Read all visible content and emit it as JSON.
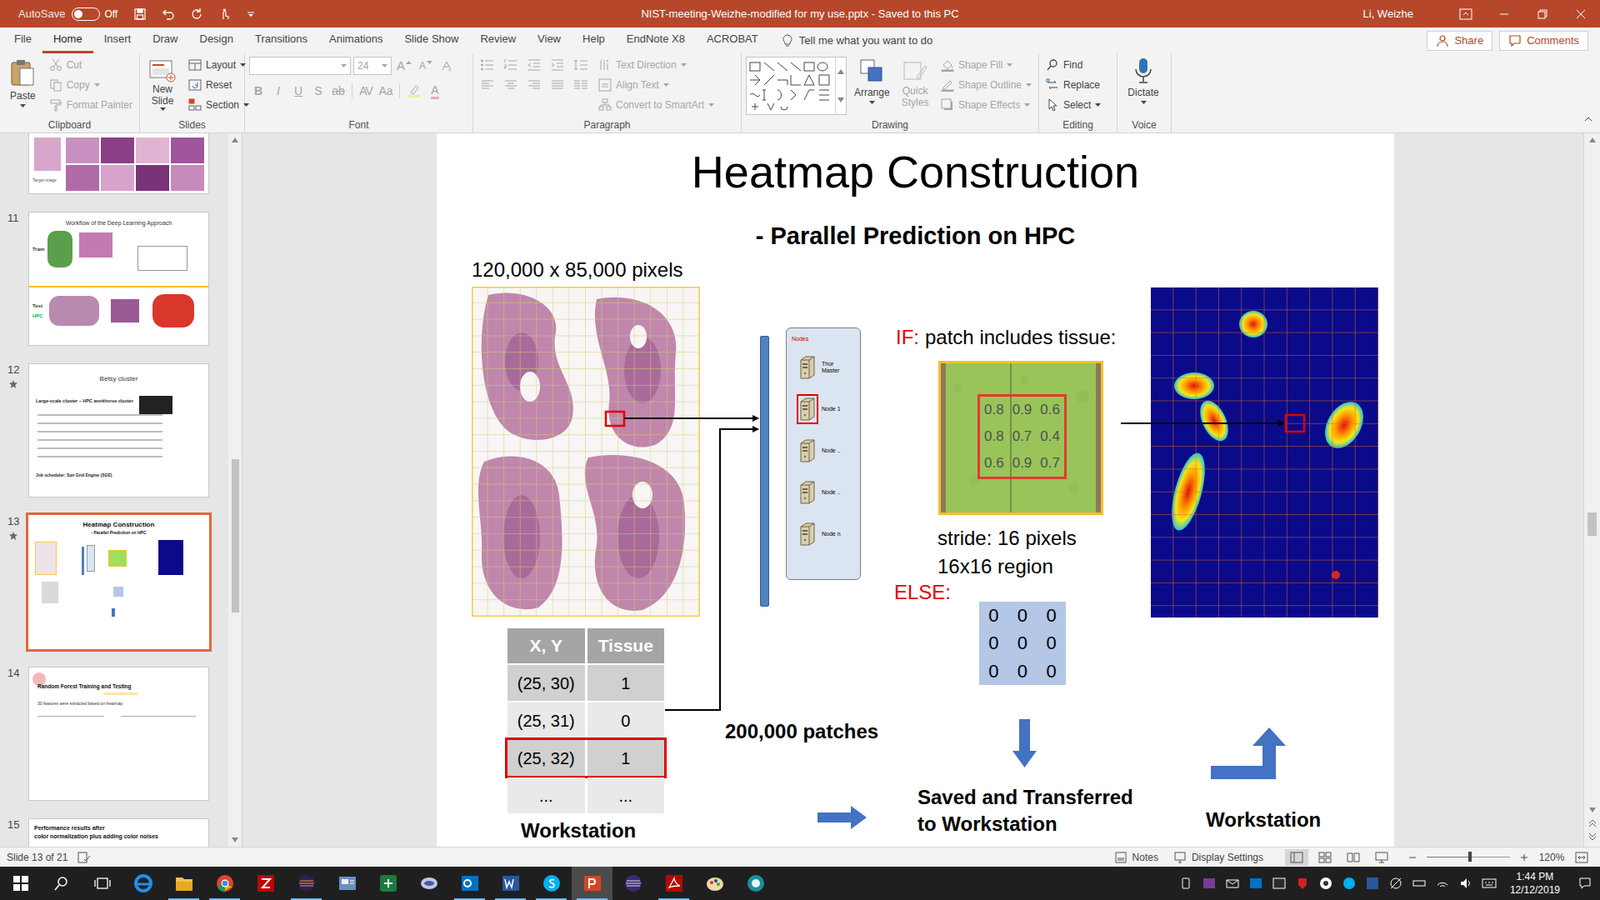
{
  "window": {
    "title": "NIST-meeting-Weizhe-modified for my use.pptx - Saved to this PC",
    "user": "Li, Weizhe",
    "autosave": {
      "label": "AutoSave",
      "state": "Off",
      "on": false
    }
  },
  "menu_tabs": [
    {
      "label": "File",
      "selected": false
    },
    {
      "label": "Home",
      "selected": true
    },
    {
      "label": "Insert",
      "selected": false
    },
    {
      "label": "Draw",
      "selected": false
    },
    {
      "label": "Design",
      "selected": false
    },
    {
      "label": "Transitions",
      "selected": false
    },
    {
      "label": "Animations",
      "selected": false
    },
    {
      "label": "Slide Show",
      "selected": false
    },
    {
      "label": "Review",
      "selected": false
    },
    {
      "label": "View",
      "selected": false
    },
    {
      "label": "Help",
      "selected": false
    },
    {
      "label": "EndNote X8",
      "selected": false
    },
    {
      "label": "ACROBAT",
      "selected": false
    }
  ],
  "tell_me": "Tell me what you want to do",
  "share": "Share",
  "comments": "Comments",
  "ribbon": {
    "clipboard": {
      "label": "Clipboard",
      "paste": "Paste",
      "items": [
        {
          "label": "Cut",
          "disabled": true
        },
        {
          "label": "Copy",
          "disabled": true
        },
        {
          "label": "Format Painter",
          "disabled": true
        }
      ]
    },
    "slides": {
      "label": "Slides",
      "new_slide": "New Slide",
      "items": [
        {
          "label": "Layout",
          "disabled": false
        },
        {
          "label": "Reset",
          "disabled": false
        },
        {
          "label": "Section",
          "disabled": false
        }
      ]
    },
    "font": {
      "label": "Font",
      "size": "24",
      "row1": [
        {
          "label": "A",
          "disabled": true
        },
        {
          "label": "A",
          "disabled": true
        }
      ],
      "row2": [
        {
          "label": "B",
          "disabled": true
        },
        {
          "label": "I",
          "disabled": true
        },
        {
          "label": "U",
          "disabled": true
        },
        {
          "label": "S",
          "disabled": true
        },
        {
          "label": "ab",
          "disabled": true
        },
        {
          "label": "AV",
          "disabled": true
        },
        {
          "label": "Aa",
          "disabled": true
        },
        {
          "label": "A",
          "disabled": true
        }
      ]
    },
    "paragraph": {
      "label": "Paragraph",
      "items": [
        {
          "label": "Text Direction",
          "disabled": true
        },
        {
          "label": "Align Text",
          "disabled": true
        },
        {
          "label": "Convert to SmartArt",
          "disabled": true
        }
      ]
    },
    "drawing": {
      "label": "Drawing",
      "arrange": {
        "label": "Arrange",
        "disabled": false
      },
      "quick_styles": {
        "label": "Quick Styles",
        "disabled": true
      },
      "items": [
        {
          "label": "Shape Fill",
          "disabled": true
        },
        {
          "label": "Shape Outline",
          "disabled": true
        },
        {
          "label": "Shape Effects",
          "disabled": true
        }
      ]
    },
    "editing": {
      "label": "Editing",
      "items": [
        {
          "label": "Find",
          "disabled": false
        },
        {
          "label": "Replace",
          "disabled": false
        },
        {
          "label": "Select",
          "disabled": false
        }
      ]
    },
    "voice": {
      "label": "Voice",
      "dictate": "Dictate"
    }
  },
  "thumbnails": [
    {
      "selected": false,
      "starred": false,
      "texts": [
        "Target image"
      ]
    },
    {
      "number": "11",
      "selected": false,
      "starred": false,
      "texts": [
        "Workflow of the Deep Learning Approach",
        "Train",
        "Test",
        "HPC"
      ]
    },
    {
      "number": "12",
      "selected": false,
      "starred": true,
      "texts": [
        "Betsy cluster",
        "Large-scale cluster – HPC workhorse cluster",
        "Job scheduler: Sun Grid Engine (SGE)"
      ]
    },
    {
      "number": "13",
      "selected": true,
      "starred": true,
      "texts": [
        "Heatmap Construction",
        "- Parallel Prediction on HPC"
      ]
    },
    {
      "number": "14",
      "selected": false,
      "starred": false,
      "texts": [
        "Random Forest Training and Testing",
        "30 features were extracted based on heatmap"
      ]
    },
    {
      "number": "15",
      "selected": false,
      "starred": false,
      "texts": [
        "Performance results after",
        "color normalization plus adding color noises"
      ]
    }
  ],
  "slide": {
    "title": "Heatmap Construction",
    "subtitle": "- Parallel Prediction on HPC",
    "image_size": "120,000 x 85,000 pixels",
    "table": {
      "columns": [
        "X, Y",
        "Tissue"
      ],
      "rows": [
        {
          "cells": [
            "(25, 30)",
            "1"
          ],
          "selected": false
        },
        {
          "cells": [
            "(25, 31)",
            "0"
          ],
          "selected": false
        },
        {
          "cells": [
            "(25, 32)",
            "1"
          ],
          "selected": true
        },
        {
          "cells": [
            "...",
            "..."
          ],
          "selected": false
        }
      ]
    },
    "workstation_left": "Workstation",
    "cluster": {
      "label": "Nodes",
      "nodes": [
        {
          "label": "Thor Master",
          "selected": false
        },
        {
          "label": "Node 1",
          "selected": true
        },
        {
          "label": "Node ..",
          "selected": false
        },
        {
          "label": "Node ..",
          "selected": false
        },
        {
          "label": "Node n",
          "selected": false
        }
      ]
    },
    "patches": "200,000 patches",
    "if_keyword": "IF:",
    "if_text": "patch includes tissue:",
    "probabilities": [
      [
        "0.8",
        "0.9",
        "0.6"
      ],
      [
        "0.8",
        "0.7",
        "0.4"
      ],
      [
        "0.6",
        "0.9",
        "0.7"
      ]
    ],
    "stride": "stride: 16 pixels",
    "region": "16x16 region",
    "else_keyword": "ELSE:",
    "zeros": [
      [
        "0",
        "0",
        "0"
      ],
      [
        "0",
        "0",
        "0"
      ],
      [
        "0",
        "0",
        "0"
      ]
    ],
    "saved": [
      "Saved and Transferred",
      "to Workstation"
    ],
    "workstation_right": "Workstation"
  },
  "status_bar": {
    "slide": "Slide 13 of 21",
    "notes": "Notes",
    "display": "Display Settings",
    "zoom": "120%",
    "zoom_level": 0.52
  },
  "taskbar": {
    "apps": [
      {
        "running": false,
        "selected": false
      },
      {
        "running": false,
        "selected": false
      },
      {
        "running": false,
        "selected": false
      },
      {
        "running": false,
        "selected": false
      },
      {
        "running": true,
        "selected": false
      },
      {
        "running": true,
        "selected": false
      },
      {
        "running": false,
        "selected": false
      },
      {
        "running": true,
        "selected": false
      },
      {
        "running": false,
        "selected": false
      },
      {
        "running": false,
        "selected": false
      },
      {
        "running": false,
        "selected": false
      },
      {
        "running": true,
        "selected": false
      },
      {
        "running": true,
        "selected": false
      },
      {
        "running": true,
        "selected": false
      },
      {
        "running": true,
        "selected": true
      },
      {
        "running": false,
        "selected": false
      },
      {
        "running": true,
        "selected": false
      },
      {
        "running": false,
        "selected": false
      },
      {
        "running": false,
        "selected": false
      }
    ],
    "time": "1:44 PM",
    "date": "12/12/2019"
  }
}
